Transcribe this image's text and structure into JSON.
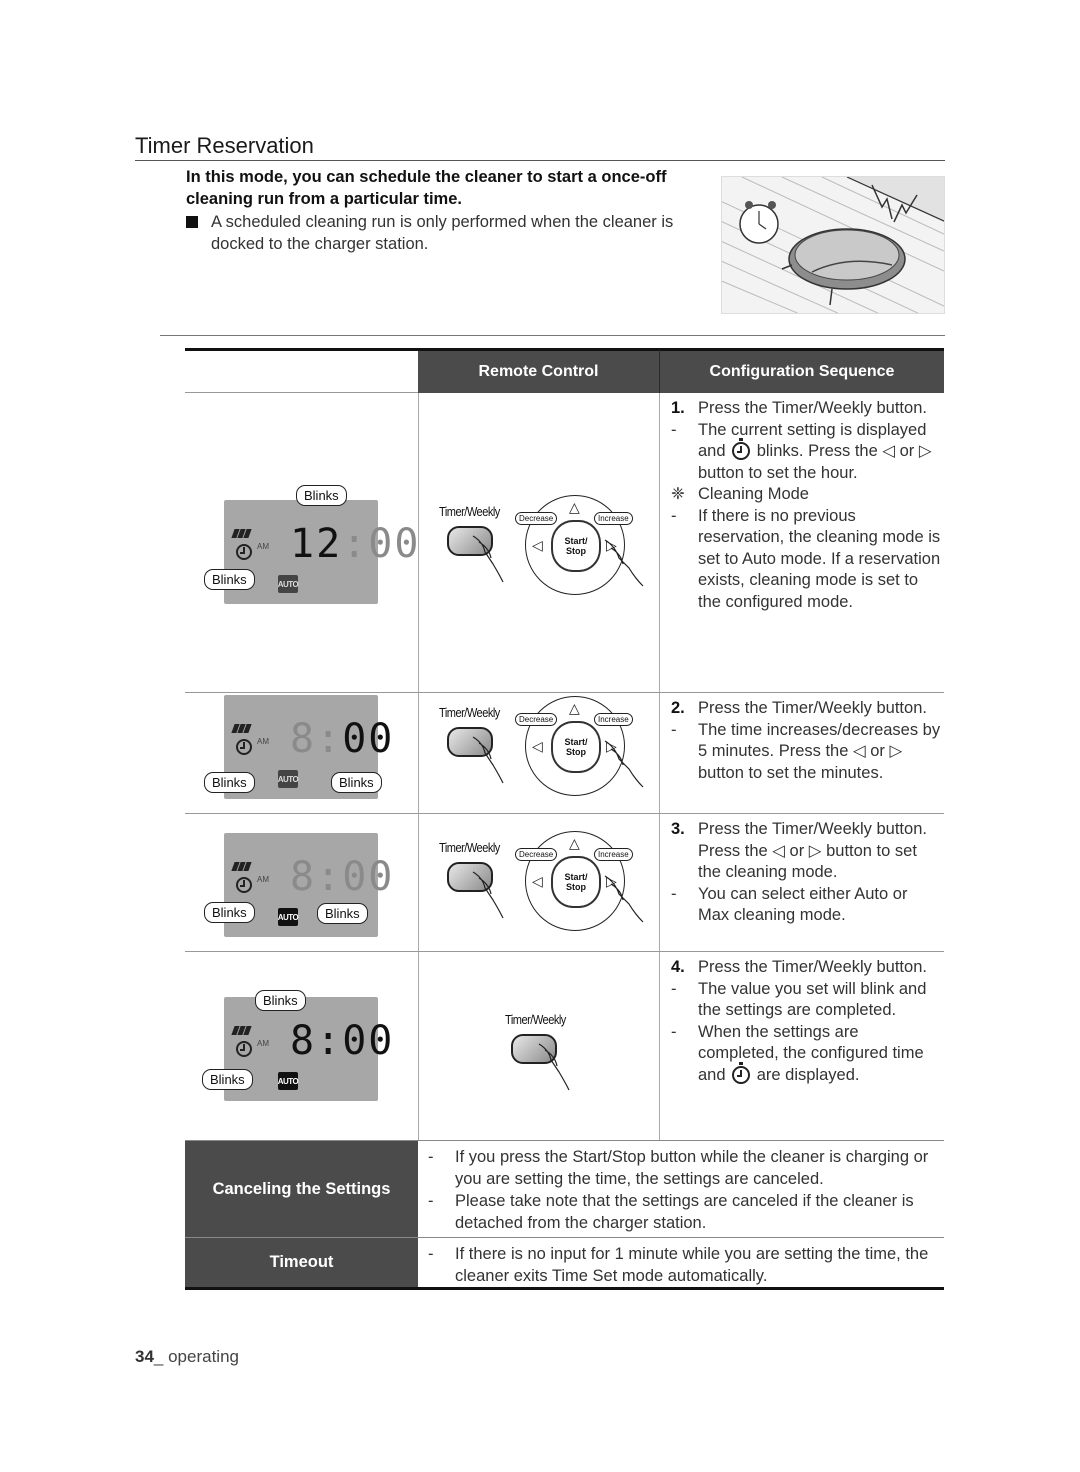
{
  "page": {
    "title": "Timer Reservation",
    "intro": "In this mode, you can schedule the cleaner to start a once-off cleaning run from a particular time.",
    "note": "A scheduled cleaning run is only performed when the cleaner is docked to the charger station.",
    "footer_page": "34",
    "footer_section": "_ operating"
  },
  "illustration": {
    "alt": "robot cleaner docked with alarm clock"
  },
  "table": {
    "headers": {
      "blank": "",
      "remote": "Remote Control",
      "config": "Configuration Sequence"
    },
    "rows": [
      {
        "lcd": {
          "time_hour": "12",
          "time_min": "00",
          "am": "AM",
          "mode": "AUTO",
          "blink_top": "Blinks",
          "blink_left": "Blinks"
        },
        "remote": {
          "timer_label": "Timer/Weekly",
          "decrease": "Decrease",
          "increase": "Increase",
          "start_stop_1": "Start/",
          "start_stop_2": "Stop"
        },
        "steps": [
          {
            "marker": "1.",
            "text": "Press the Timer/Weekly button."
          },
          {
            "marker": "-",
            "text_before": "The current setting is displayed and",
            "text_after": "blinks. Press the ◁ or ▷ button to set the hour."
          },
          {
            "marker": "❈",
            "text": "Cleaning Mode"
          },
          {
            "marker": "-",
            "text": "If there is no previous reservation, the cleaning mode is set to Auto mode. If a reservation exists, cleaning mode is set to the configured mode."
          }
        ]
      },
      {
        "lcd": {
          "time_hour": "8",
          "time_min": "00",
          "am": "AM",
          "mode": "AUTO",
          "blink_left": "Blinks",
          "blink_right": "Blinks"
        },
        "remote": {
          "timer_label": "Timer/Weekly",
          "decrease": "Decrease",
          "increase": "Increase",
          "start_stop_1": "Start/",
          "start_stop_2": "Stop"
        },
        "steps": [
          {
            "marker": "2.",
            "text": "Press the Timer/Weekly button."
          },
          {
            "marker": "-",
            "text": "The time increases/decreases by 5 minutes. Press the ◁ or ▷ button to set the minutes."
          }
        ]
      },
      {
        "lcd": {
          "time_hour": "8",
          "time_min": "00",
          "am": "AM",
          "mode": "AUTO",
          "blink_left": "Blinks",
          "blink_right": "Blinks"
        },
        "remote": {
          "timer_label": "Timer/Weekly",
          "decrease": "Decrease",
          "increase": "Increase",
          "start_stop_1": "Start/",
          "start_stop_2": "Stop"
        },
        "steps": [
          {
            "marker": "3.",
            "text": "Press the Timer/Weekly button. Press the ◁ or ▷ button to set the cleaning mode."
          },
          {
            "marker": "-",
            "text": "You can select either Auto or Max cleaning mode."
          }
        ]
      },
      {
        "lcd": {
          "time_hour": "8",
          "time_min": "00",
          "am": "AM",
          "mode": "AUTO",
          "blink_top": "Blinks",
          "blink_left": "Blinks"
        },
        "remote": {
          "timer_label": "Timer/Weekly"
        },
        "steps": [
          {
            "marker": "4.",
            "text": "Press the Timer/Weekly button."
          },
          {
            "marker": "-",
            "text": "The value you set will blink and the settings are completed."
          },
          {
            "marker": "-",
            "text_before": "When the settings are completed, the configured time and",
            "text_after": "are displayed."
          }
        ]
      }
    ],
    "canceling": {
      "label": "Canceling the Settings",
      "lines": [
        "If you press the Start/Stop button while the cleaner is charging or you are setting the time, the settings are canceled.",
        "Please take note that the settings are canceled if the cleaner is detached from the charger station."
      ]
    },
    "timeout": {
      "label": "Timeout",
      "lines": [
        "If there is no input for 1 minute while you are setting the time, the cleaner exits Time Set mode automatically."
      ]
    }
  }
}
